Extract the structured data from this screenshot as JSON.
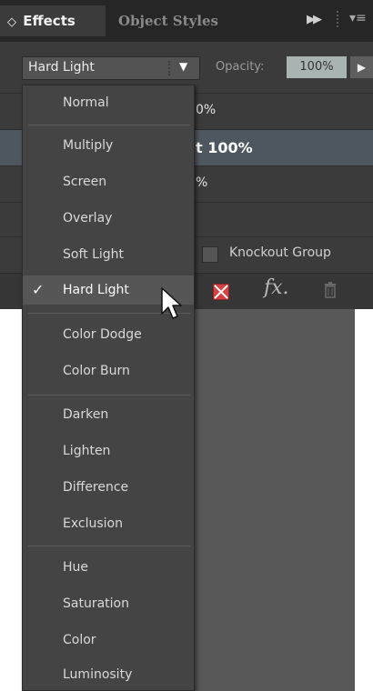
{
  "tabs": {
    "effects": "Effects",
    "effects_arrow": "◇",
    "object_styles": "Object Styles"
  },
  "blend": {
    "value": "Hard Light",
    "opacity_label": "Opacity:",
    "opacity_value": "100%"
  },
  "rows": {
    "row1": "0%",
    "row2": "t 100%",
    "row3": "%"
  },
  "knockout_label": "Knockout Group",
  "fx_label": "fx.",
  "menu": {
    "items": [
      "Normal",
      "Multiply",
      "Screen",
      "Overlay",
      "Soft Light",
      "Hard Light",
      "Color Dodge",
      "Color Burn",
      "Darken",
      "Lighten",
      "Difference",
      "Exclusion",
      "Hue",
      "Saturation",
      "Color",
      "Luminosity"
    ],
    "selected": "Hard Light",
    "check": "✓"
  },
  "colors": {
    "panel": "#3b3b3b",
    "tabbar": "#262626",
    "selected_row": "#4e5760",
    "opacity_field": "#a9b4b2",
    "dropdown": "#444444"
  }
}
